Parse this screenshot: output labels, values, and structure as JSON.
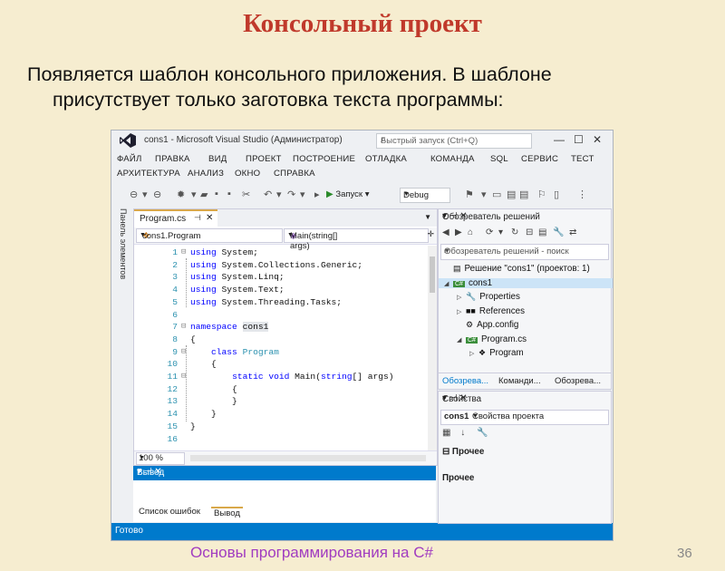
{
  "slide": {
    "title": "Консольный проект",
    "text_line1": "Появляется шаблон консольного приложения. В шаблоне",
    "text_line2": "присутствует только заготовка текста программы:",
    "footer": "Основы программирования на C#",
    "page_number": "36"
  },
  "window": {
    "title": "cons1 - Microsoft Visual Studio (Администратор)",
    "quick_launch_placeholder": "Быстрый запуск (Ctrl+Q)",
    "minimize": "—",
    "maximize": "☐",
    "close": "✕"
  },
  "menu": {
    "row1": [
      "ФАЙЛ",
      "ПРАВКА",
      "ВИД",
      "ПРОЕКТ",
      "ПОСТРОЕНИЕ",
      "ОТЛАДКА",
      "КОМАНДА",
      "SQL",
      "СЕРВИС",
      "ТЕСТ"
    ],
    "row2": [
      "АРХИТЕКТУРА",
      "АНАЛИЗ",
      "ОКНО",
      "СПРАВКА"
    ]
  },
  "toolbar": {
    "run_label": "Запуск",
    "config": "Debug"
  },
  "side_tab": "Панель элементов",
  "editor": {
    "tab_label": "Program.cs",
    "nav_left": "cons1.Program",
    "nav_right": "Main(string[] args)",
    "zoom": "100 %",
    "lines": [
      {
        "n": "1",
        "fold": "⊟",
        "parts": [
          {
            "k": "kw",
            "t": "using"
          },
          {
            "k": "",
            "t": " System;"
          }
        ]
      },
      {
        "n": "2",
        "fold": "",
        "parts": [
          {
            "k": "kw",
            "t": "using"
          },
          {
            "k": "",
            "t": " System.Collections.Generic;"
          }
        ]
      },
      {
        "n": "3",
        "fold": "",
        "parts": [
          {
            "k": "kw",
            "t": "using"
          },
          {
            "k": "",
            "t": " System.Linq;"
          }
        ]
      },
      {
        "n": "4",
        "fold": "",
        "parts": [
          {
            "k": "kw",
            "t": "using"
          },
          {
            "k": "",
            "t": " System.Text;"
          }
        ]
      },
      {
        "n": "5",
        "fold": "",
        "parts": [
          {
            "k": "kw",
            "t": "using"
          },
          {
            "k": "",
            "t": " System.Threading.Tasks;"
          }
        ]
      },
      {
        "n": "6",
        "fold": "",
        "parts": []
      },
      {
        "n": "7",
        "fold": "⊟",
        "parts": [
          {
            "k": "kw",
            "t": "namespace"
          },
          {
            "k": "",
            "t": " "
          },
          {
            "k": "hl",
            "t": "cons1"
          }
        ]
      },
      {
        "n": "8",
        "fold": "",
        "parts": [
          {
            "k": "",
            "t": "{"
          }
        ]
      },
      {
        "n": "9",
        "fold": "⊟",
        "parts": [
          {
            "k": "",
            "t": "    "
          },
          {
            "k": "kw",
            "t": "class"
          },
          {
            "k": "",
            "t": " "
          },
          {
            "k": "ty",
            "t": "Program"
          }
        ]
      },
      {
        "n": "10",
        "fold": "",
        "parts": [
          {
            "k": "",
            "t": "    {"
          }
        ]
      },
      {
        "n": "11",
        "fold": "⊟",
        "parts": [
          {
            "k": "",
            "t": "        "
          },
          {
            "k": "kw",
            "t": "static"
          },
          {
            "k": "",
            "t": " "
          },
          {
            "k": "kw",
            "t": "void"
          },
          {
            "k": "",
            "t": " Main("
          },
          {
            "k": "kw",
            "t": "string"
          },
          {
            "k": "",
            "t": "[] args)"
          }
        ]
      },
      {
        "n": "12",
        "fold": "",
        "parts": [
          {
            "k": "",
            "t": "        {"
          }
        ]
      },
      {
        "n": "13",
        "fold": "",
        "parts": [
          {
            "k": "",
            "t": "        }"
          }
        ]
      },
      {
        "n": "14",
        "fold": "",
        "parts": [
          {
            "k": "",
            "t": "    }"
          }
        ]
      },
      {
        "n": "15",
        "fold": "",
        "parts": [
          {
            "k": "",
            "t": "}"
          }
        ]
      },
      {
        "n": "16",
        "fold": "",
        "parts": []
      }
    ]
  },
  "output": {
    "title": "Вывод",
    "controls": "▾ ⊣ ✕",
    "tab_errors": "Список ошибок",
    "tab_output": "Вывод"
  },
  "status": "Готово",
  "solution_explorer": {
    "title": "Обозреватель решений",
    "controls": "▾ ⊣ ✕",
    "search_placeholder": "Обозреватель решений - поиск",
    "nodes": [
      {
        "label": "Решение \"cons1\" (проектов: 1)",
        "indent": 0,
        "arrow": "",
        "icon": "▤"
      },
      {
        "label": "cons1",
        "indent": 0,
        "arrow": "◢",
        "icon": "C#",
        "selected": true
      },
      {
        "label": "Properties",
        "indent": 1,
        "arrow": "▷",
        "icon": "🔧"
      },
      {
        "label": "References",
        "indent": 1,
        "arrow": "▷",
        "icon": "■■"
      },
      {
        "label": "App.config",
        "indent": 1,
        "arrow": "",
        "icon": "⚙"
      },
      {
        "label": "Program.cs",
        "indent": 1,
        "arrow": "◢",
        "icon": "C#"
      },
      {
        "label": "Program",
        "indent": 2,
        "arrow": "▷",
        "icon": "❖"
      }
    ],
    "tabs": [
      "Обозрева...",
      "Команди...",
      "Обозрева..."
    ]
  },
  "properties": {
    "title": "Свойства",
    "controls": "▾ ⊣ ✕",
    "object_name": "cons1",
    "object_type": "Свойства проекта",
    "category": "⊟ Прочее",
    "description": "Прочее"
  }
}
